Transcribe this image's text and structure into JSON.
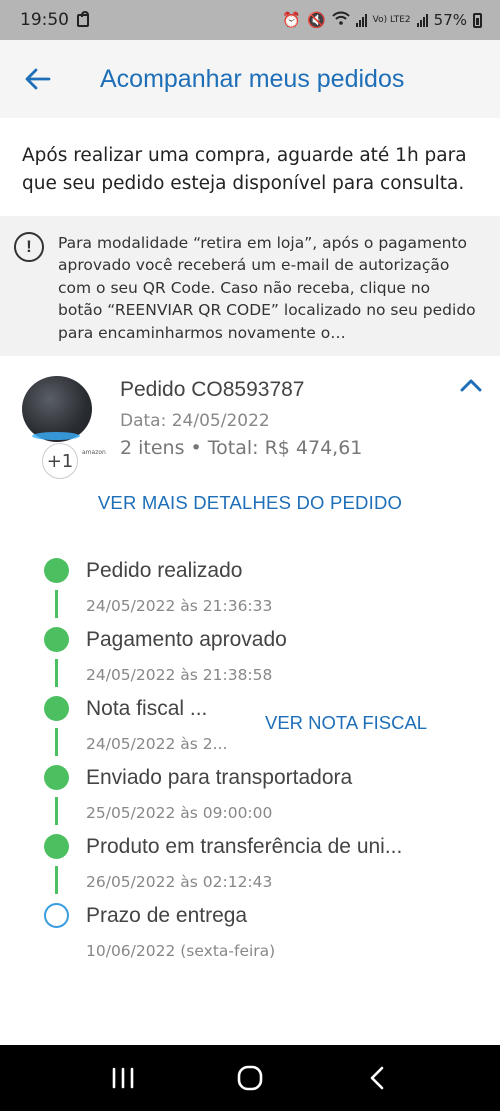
{
  "status_bar": {
    "time": "19:50",
    "network": "Vo) LTE2",
    "battery": "57%"
  },
  "header": {
    "title": "Acompanhar meus pedidos"
  },
  "intro": {
    "text": "Após realizar uma compra, aguarde até 1h para que seu pedido esteja disponível para consulta."
  },
  "notice": {
    "text": "Para modalidade “retira em loja”, após o pagamento aprovado você receberá um e-mail de autorização com o seu QR Code. Caso não receba, clique no botão “REENVIAR QR CODE” localizado no seu pedido para encaminharmos novamente o…"
  },
  "order": {
    "number": "Pedido CO8593787",
    "date": "Data: 24/05/2022",
    "summary": "2 itens • Total: R$ 474,61",
    "extra_items": "+1",
    "product_brand": "amazon",
    "details_link": "VER MAIS DETALHES DO PEDIDO"
  },
  "timeline": [
    {
      "title": "Pedido realizado",
      "date": "24/05/2022 às 21:36:33",
      "status": "done"
    },
    {
      "title": "Pagamento aprovado",
      "date": "24/05/2022 às 21:38:58",
      "status": "done"
    },
    {
      "title": "Nota fiscal ...",
      "date": "24/05/2022 às 2...",
      "status": "done",
      "action": "VER NOTA FISCAL"
    },
    {
      "title": "Enviado para transportadora",
      "date": "25/05/2022 às 09:00:00",
      "status": "done"
    },
    {
      "title": "Produto em transferência de uni...",
      "date": "26/05/2022 às 02:12:43",
      "status": "done"
    },
    {
      "title": "Prazo de entrega",
      "date": "10/06/2022 (sexta-feira)",
      "status": "pending"
    }
  ],
  "colors": {
    "accent": "#1e6fb8",
    "done": "#4cbf60",
    "pending_ring": "#3a9de0"
  }
}
